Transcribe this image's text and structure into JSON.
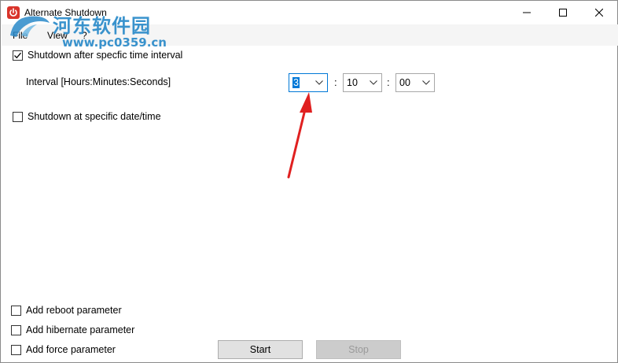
{
  "window": {
    "title": "Alternate Shutdown"
  },
  "watermark": {
    "cn_text": "河东软件园",
    "url_text": "www.pc0359.cn"
  },
  "menu": {
    "file": "File",
    "view": "View",
    "help": "?"
  },
  "options": {
    "after_interval_label": "Shutdown after specfic time interval",
    "after_interval_checked": true,
    "at_datetime_label": "Shutdown at specific date/time",
    "at_datetime_checked": false
  },
  "interval": {
    "label": "Interval [Hours:Minutes:Seconds]",
    "hours": "3",
    "minutes": "10",
    "seconds": "00",
    "separator": ":"
  },
  "parameters": {
    "reboot_label": "Add reboot parameter",
    "hibernate_label": "Add hibernate parameter",
    "force_label": "Add force parameter"
  },
  "buttons": {
    "start": "Start",
    "stop": "Stop"
  },
  "colors": {
    "accent": "#0078d7",
    "arrow": "#e02020",
    "app_icon": "#d9342b",
    "watermark": "#2a8ac9"
  },
  "icons": {
    "app": "power-icon",
    "minimize": "minimize-icon",
    "maximize": "maximize-icon",
    "close": "close-icon",
    "dropdown": "chevron-down-icon",
    "checkmark": "checkmark-icon"
  }
}
